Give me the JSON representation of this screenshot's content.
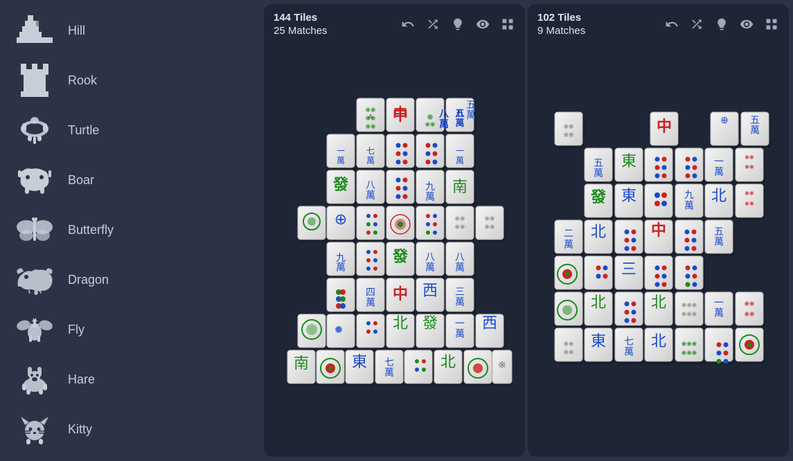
{
  "sidebar": {
    "items": [
      {
        "id": "hill",
        "label": "Hill"
      },
      {
        "id": "rook",
        "label": "Rook"
      },
      {
        "id": "turtle",
        "label": "Turtle"
      },
      {
        "id": "boar",
        "label": "Boar"
      },
      {
        "id": "butterfly",
        "label": "Butterfly"
      },
      {
        "id": "dragon",
        "label": "Dragon"
      },
      {
        "id": "fly",
        "label": "Fly"
      },
      {
        "id": "hare",
        "label": "Hare"
      },
      {
        "id": "kitty",
        "label": "Kitty"
      }
    ]
  },
  "panels": [
    {
      "id": "panel1",
      "tiles_label": "144 Tiles",
      "matches_label": "25 Matches"
    },
    {
      "id": "panel2",
      "tiles_label": "102 Tiles",
      "matches_label": "9 Matches"
    }
  ],
  "controls": {
    "undo_label": "undo",
    "shuffle_label": "shuffle",
    "hint_label": "hint",
    "preview_label": "preview",
    "layout_label": "layout"
  },
  "colors": {
    "bg": "#2c3347",
    "panel_bg": "#1e2535",
    "text": "#e0e4ef",
    "icon": "#a0a8bc"
  }
}
